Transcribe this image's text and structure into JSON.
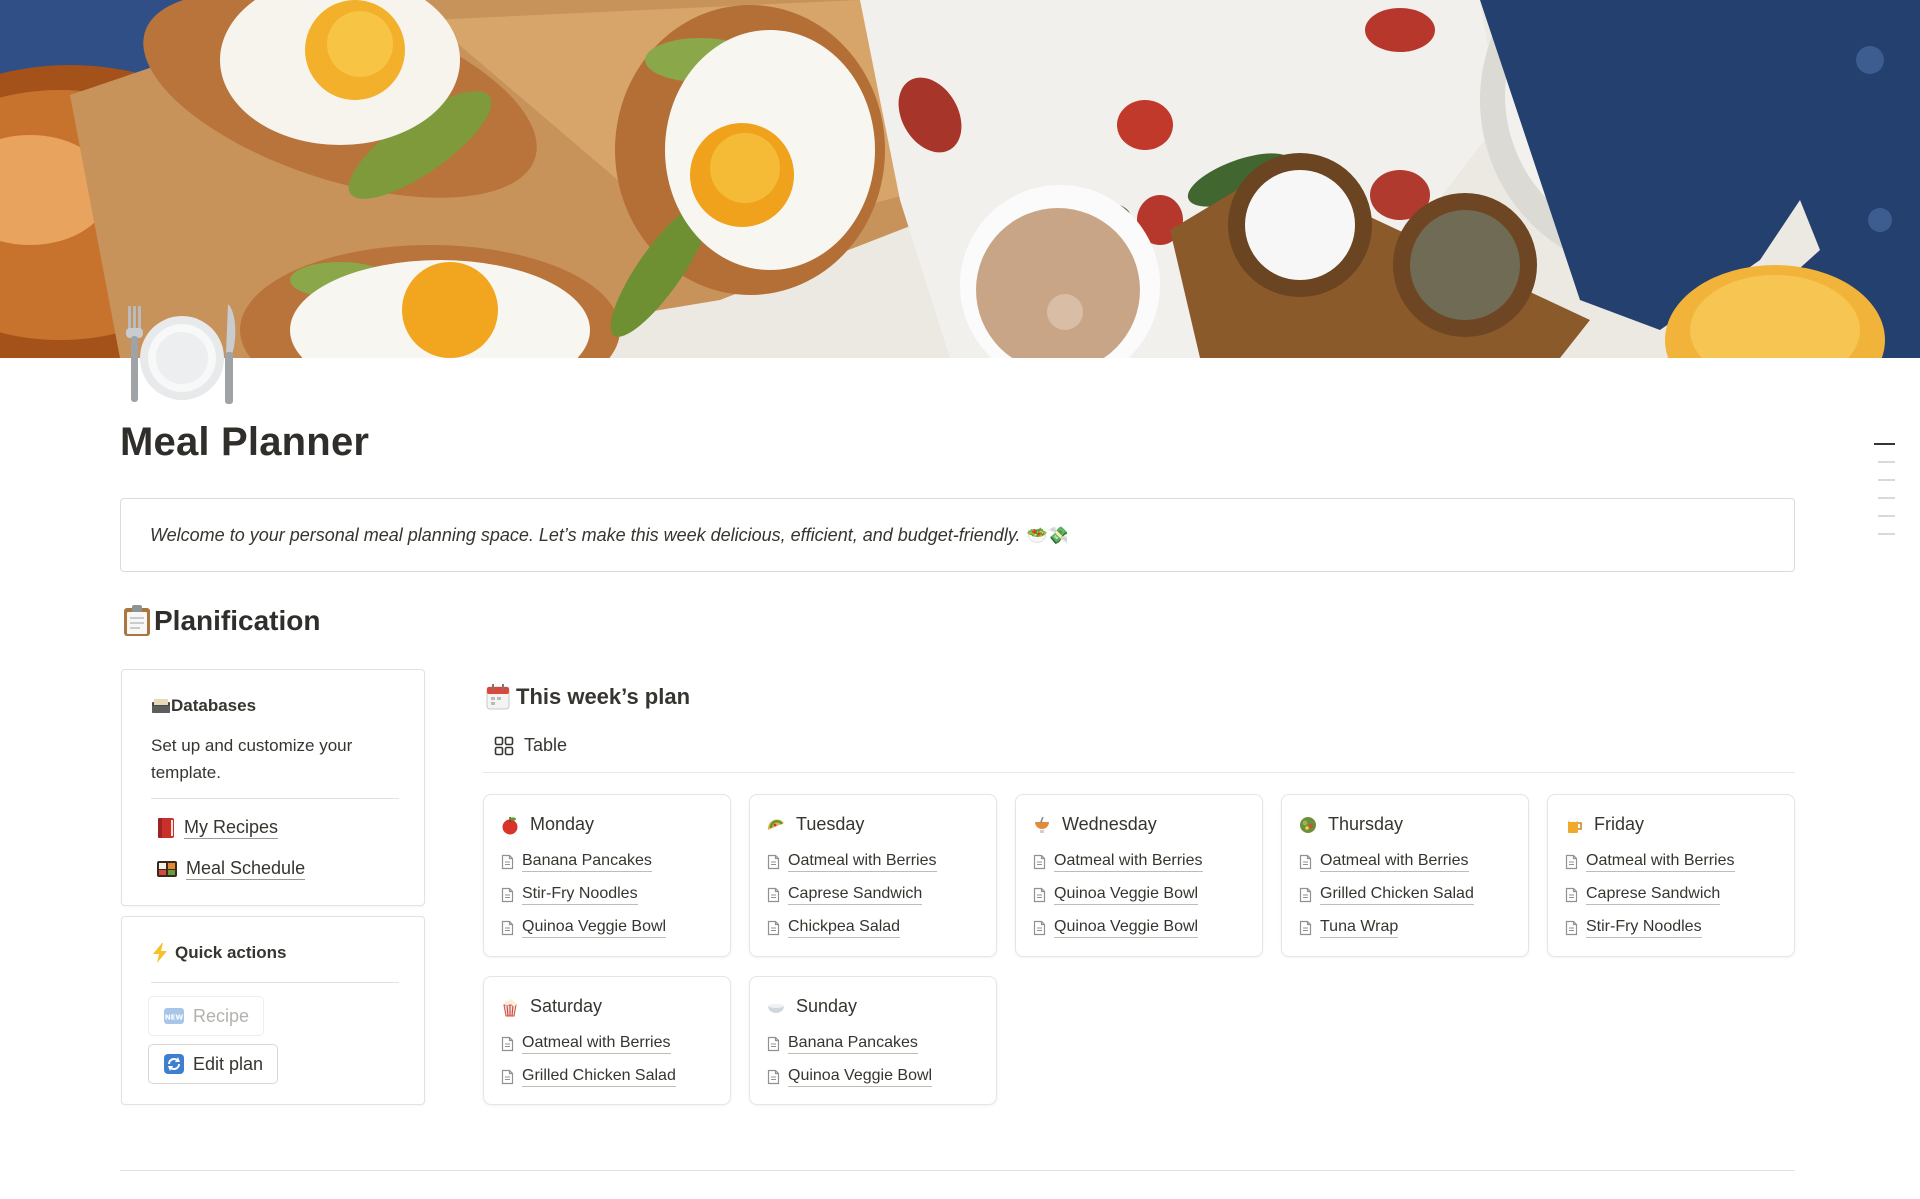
{
  "page": {
    "title": "Meal Planner",
    "icon": "plate-with-cutlery-icon",
    "cover": "breakfast-table-photo"
  },
  "callout": {
    "text": "Welcome to your personal meal planning space. Let’s make this week delicious, efficient, and budget-friendly.",
    "emoji": "🥗💸"
  },
  "section": {
    "title": "Planification",
    "icon": "clipboard-icon"
  },
  "databases": {
    "title": "Databases",
    "icon": "card-box-icon",
    "description": "Set up and customize your template.",
    "links": [
      {
        "label": "My Recipes",
        "icon": "red-book-icon"
      },
      {
        "label": "Meal Schedule",
        "icon": "bento-box-icon"
      }
    ]
  },
  "quick_actions": {
    "title": "Quick actions",
    "icon": "lightning-icon",
    "buttons": [
      {
        "label": "Recipe",
        "icon": "new-icon",
        "state": "disabled"
      },
      {
        "label": "Edit plan",
        "icon": "refresh-icon",
        "state": "enabled"
      }
    ]
  },
  "plan": {
    "title": "This week’s plan",
    "icon": "calendar-icon",
    "view": {
      "label": "Table",
      "icon": "grid-icon"
    },
    "days": [
      {
        "name": "Monday",
        "icon": "apple-icon",
        "meals": [
          "Banana Pancakes",
          "Stir-Fry Noodles",
          "Quinoa Veggie Bowl"
        ]
      },
      {
        "name": "Tuesday",
        "icon": "taco-icon",
        "meals": [
          "Oatmeal with Berries",
          "Caprese Sandwich",
          "Chickpea Salad"
        ]
      },
      {
        "name": "Wednesday",
        "icon": "drink-icon",
        "meals": [
          "Oatmeal with Berries",
          "Quinoa Veggie Bowl",
          "Quinoa Veggie Bowl"
        ]
      },
      {
        "name": "Thursday",
        "icon": "salad-icon",
        "meals": [
          "Oatmeal with Berries",
          "Grilled Chicken Salad",
          "Tuna Wrap"
        ]
      },
      {
        "name": "Friday",
        "icon": "beer-icon",
        "meals": [
          "Oatmeal with Berries",
          "Caprese Sandwich",
          "Stir-Fry Noodles"
        ]
      },
      {
        "name": "Saturday",
        "icon": "popcorn-icon",
        "meals": [
          "Oatmeal with Berries",
          "Grilled Chicken Salad"
        ]
      },
      {
        "name": "Sunday",
        "icon": "bowl-icon",
        "meals": [
          "Banana Pancakes",
          "Quinoa Veggie Bowl"
        ]
      }
    ]
  },
  "colors": {
    "text": "#37352f",
    "border": "#e3e2de",
    "muted": "#b3b2ae"
  }
}
